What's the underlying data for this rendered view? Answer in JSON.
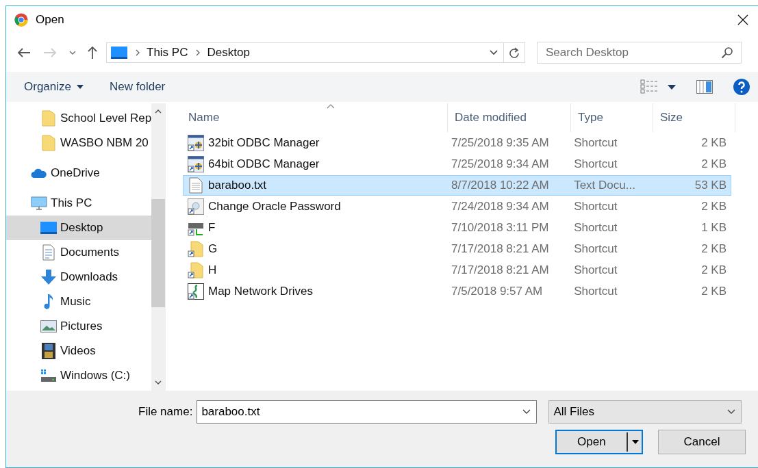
{
  "window": {
    "title": "Open"
  },
  "address_bar": {
    "path": [
      "This PC",
      "Desktop"
    ]
  },
  "search": {
    "placeholder": "Search Desktop"
  },
  "toolbar": {
    "buttons": [
      "Organize",
      "New folder"
    ]
  },
  "sidebar": {
    "pinned": [
      {
        "label": "School Level Rep",
        "kind": "folder",
        "selected": false
      },
      {
        "label": "WASBO NBM 20",
        "kind": "folder",
        "selected": false
      }
    ],
    "items": [
      {
        "label": "OneDrive",
        "kind": "cloud",
        "selected": false
      },
      {
        "label": "This PC",
        "kind": "pc",
        "selected": false,
        "children": [
          {
            "label": "Desktop",
            "kind": "desktop",
            "selected": true
          },
          {
            "label": "Documents",
            "kind": "documents",
            "selected": false
          },
          {
            "label": "Downloads",
            "kind": "downloads",
            "selected": false
          },
          {
            "label": "Music",
            "kind": "music",
            "selected": false
          },
          {
            "label": "Pictures",
            "kind": "pictures",
            "selected": false
          },
          {
            "label": "Videos",
            "kind": "videos",
            "selected": false
          },
          {
            "label": "Windows (C:)",
            "kind": "drive",
            "selected": false
          }
        ]
      }
    ]
  },
  "table": {
    "columns": [
      "Name",
      "Date modified",
      "Type",
      "Size"
    ],
    "rows": [
      {
        "name": "32bit ODBC Manager",
        "kind": "odbc",
        "date": "7/25/2018 9:35 AM",
        "type": "Shortcut",
        "size": "2 KB",
        "selected": false
      },
      {
        "name": "64bit ODBC Manager",
        "kind": "odbc",
        "date": "7/25/2018 9:34 AM",
        "type": "Shortcut",
        "size": "2 KB",
        "selected": false
      },
      {
        "name": "baraboo.txt",
        "kind": "text",
        "date": "8/7/2018 10:22 AM",
        "type": "Text Docu...",
        "size": "53 KB",
        "selected": true
      },
      {
        "name": "Change Oracle Password",
        "kind": "app",
        "date": "7/24/2018 9:34 AM",
        "type": "Shortcut",
        "size": "2 KB",
        "selected": false
      },
      {
        "name": "F",
        "kind": "drive-shortcut",
        "date": "7/10/2018 3:11 PM",
        "type": "Shortcut",
        "size": "1 KB",
        "selected": false
      },
      {
        "name": "G",
        "kind": "folder-shortcut",
        "date": "7/17/2018 8:21 AM",
        "type": "Shortcut",
        "size": "2 KB",
        "selected": false
      },
      {
        "name": "H",
        "kind": "folder-shortcut",
        "date": "7/17/2018 8:21 AM",
        "type": "Shortcut",
        "size": "2 KB",
        "selected": false
      },
      {
        "name": "Map Network Drives",
        "kind": "map",
        "date": "7/5/2018 9:57 AM",
        "type": "Shortcut",
        "size": "2 KB",
        "selected": false
      }
    ]
  },
  "file_name": {
    "label": "File name:",
    "value": "baraboo.txt"
  },
  "file_type": {
    "value": "All Files"
  },
  "buttons": [
    "Open",
    "Cancel"
  ]
}
